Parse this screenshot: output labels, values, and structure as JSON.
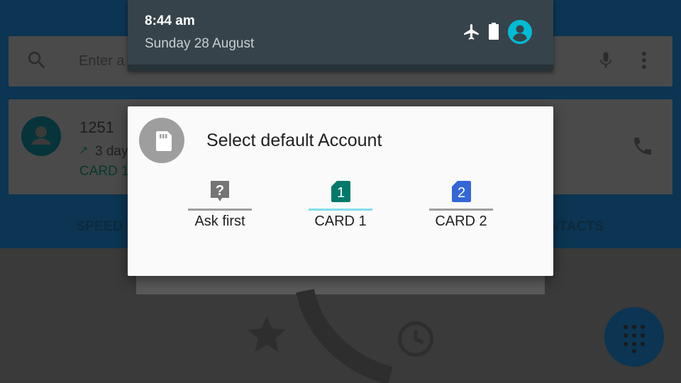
{
  "status_shade": {
    "time": "8:44 am",
    "date": "Sunday 28 August",
    "icons": [
      "airplane-mode-icon",
      "battery-icon",
      "account-icon"
    ]
  },
  "background_app": {
    "search_placeholder": "Enter a",
    "recent_call": {
      "number": "1251",
      "time_ago": "3 day",
      "card_label": "CARD 1"
    },
    "tabs": [
      "SPEED",
      "NTACTS"
    ],
    "bottom_icons": [
      "star-icon",
      "phone-icon",
      "clock-icon"
    ]
  },
  "dialog": {
    "title": "Select default Account",
    "options": [
      {
        "label": "Ask first",
        "glyph": "?",
        "color": "#757575",
        "underline": "#9e9e9e",
        "selected": false
      },
      {
        "label": "CARD 1",
        "glyph": "1",
        "color": "#00796b",
        "underline": "#80deea",
        "selected": true
      },
      {
        "label": "CARD 2",
        "glyph": "2",
        "color": "#3367d6",
        "underline": "#9e9e9e",
        "selected": false
      }
    ]
  },
  "colors": {
    "shade_bg": "#36434a",
    "dialog_bg": "#fafafa",
    "accent_cyan": "#00bcd4",
    "card1_teal": "#00796b",
    "card2_blue": "#3367d6"
  }
}
